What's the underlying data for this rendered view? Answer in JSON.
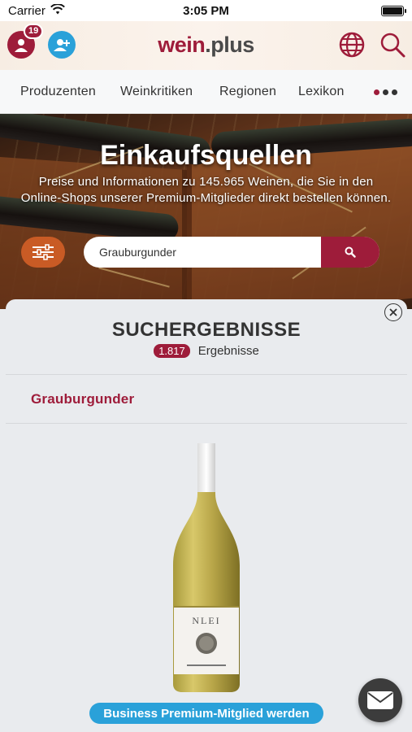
{
  "status_bar": {
    "carrier": "Carrier",
    "time": "3:05 PM"
  },
  "header": {
    "notification_count": "19",
    "logo_part1": "wein",
    "logo_part2": ".plus"
  },
  "nav": {
    "items": [
      "Produzenten",
      "Weinkritiken",
      "Regionen",
      "Lexikon"
    ]
  },
  "hero": {
    "title": "Einkaufsquellen",
    "subtitle": "Preise und Informationen zu 145.965 Weinen, die Sie in den Online-Shops unserer Premium-Mitglieder direkt bestellen können."
  },
  "search": {
    "value": "Grauburgunder"
  },
  "results": {
    "title": "SUCHERGEBNISSE",
    "count": "1.817",
    "count_label": "Ergebnisse",
    "query": "Grauburgunder"
  },
  "cta": {
    "label": "Business Premium-Mitglied werden"
  },
  "colors": {
    "brand": "#9e1c3a",
    "accent_blue": "#2aa1d9",
    "filter_orange": "#c95b25"
  },
  "icons": [
    "wifi-icon",
    "battery-icon",
    "user-icon",
    "add-user-icon",
    "globe-icon",
    "search-icon",
    "more-icon",
    "filter-icon",
    "close-icon",
    "mail-icon"
  ]
}
